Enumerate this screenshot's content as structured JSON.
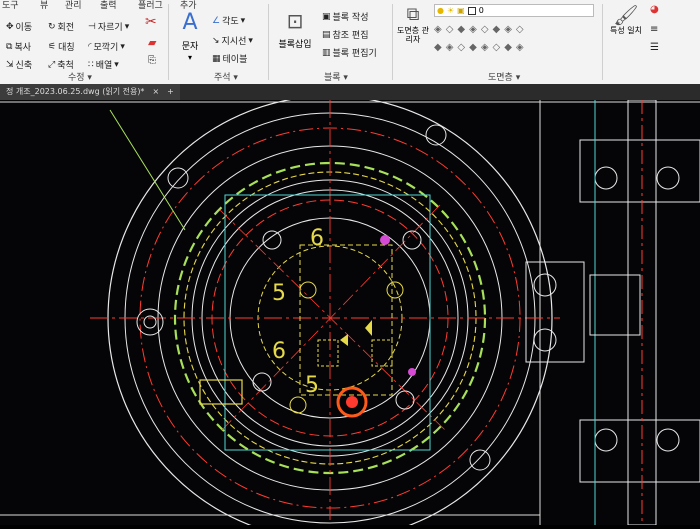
{
  "menu": [
    "도구",
    "뷰",
    "관리",
    "출력",
    "플러그",
    "추가"
  ],
  "ribbon": {
    "modify": {
      "items": [
        "이동",
        "회전",
        "자르기",
        "복사",
        "대칭",
        "모깍기",
        "신축",
        "축척",
        "배열"
      ],
      "group_label": "수정"
    },
    "annotation": {
      "text_label": "문자",
      "items": [
        "각도",
        "지시선",
        "테이블"
      ],
      "group_label": "주석"
    },
    "block": {
      "insert_label": "블록삽입",
      "items": [
        "블록 작성",
        "참조 편집",
        "블록 편집기"
      ],
      "group_label": "블록"
    },
    "layers": {
      "manager_label": "도면층 관리자",
      "layer_value": "0",
      "group_label": "도면층"
    },
    "properties": {
      "label": "특성 일치"
    }
  },
  "tab": {
    "title": "정 개조_2023.06.25.dwg (읽기 전용)*",
    "close_label": "×",
    "add_label": "+"
  },
  "drawing": {
    "labels": [
      "6",
      "5",
      "6",
      "5"
    ],
    "colors": {
      "background": "#050507",
      "white": "#e8e8e8",
      "red": "#ff3b30",
      "yellow": "#e6d94a",
      "green": "#a8e05a",
      "cyan": "#4fd6d6",
      "magenta": "#d54bd5",
      "orange": "#ff5a1a"
    }
  }
}
